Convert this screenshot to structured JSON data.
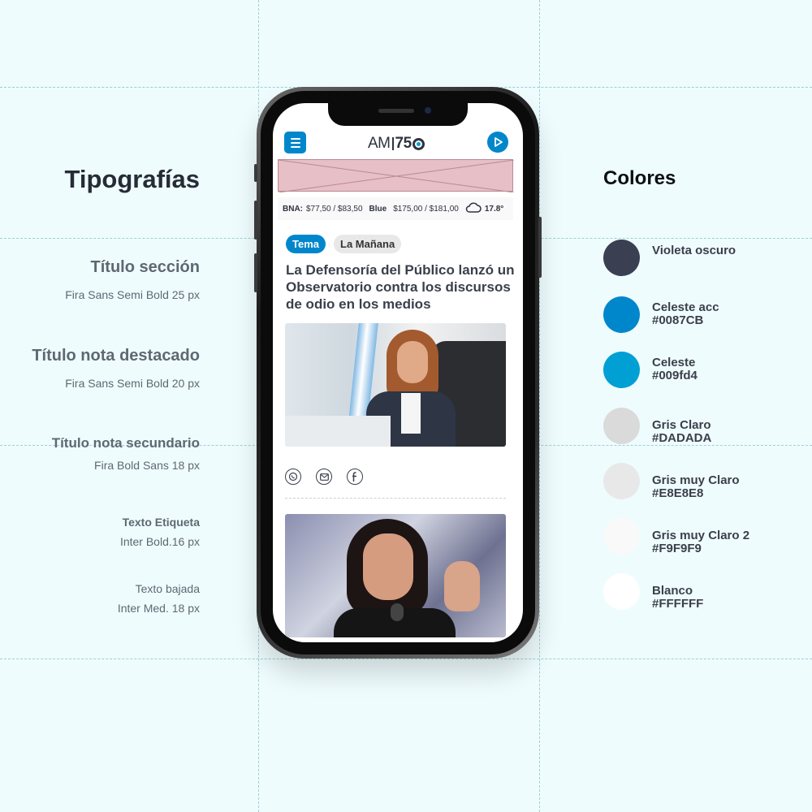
{
  "typography": {
    "title": "Tipografías",
    "items": [
      {
        "name": "Título sección",
        "spec": "Fira Sans Semi Bold 25 px"
      },
      {
        "name": "Título nota destacado",
        "spec": "Fira Sans Semi Bold 20 px"
      },
      {
        "name": "Título nota secundario",
        "spec": "Fira Bold Sans 18 px"
      },
      {
        "name": "Texto Etiqueta",
        "spec": "Inter Bold.16 px"
      },
      {
        "name": "Texto bajada",
        "spec": "Inter Med. 18 px"
      }
    ]
  },
  "colors": {
    "title": "Colores",
    "items": [
      {
        "name": "Violeta oscuro",
        "hex": "",
        "swatch": "#3A3F52"
      },
      {
        "name": "Celeste acc",
        "hex": "#0087CB",
        "swatch": "#0087CB"
      },
      {
        "name": "Celeste",
        "hex": "#009fd4",
        "swatch": "#009FD4"
      },
      {
        "name": "Gris Claro",
        "hex": "#DADADA",
        "swatch": "#DADADA"
      },
      {
        "name": "Gris muy Claro",
        "hex": "#E8E8E8",
        "swatch": "#E8E8E8"
      },
      {
        "name": "Gris muy Claro 2",
        "hex": "#F9F9F9",
        "swatch": "#F9F9F9"
      },
      {
        "name": "Blanco",
        "hex": "#FFFFFF",
        "swatch": "#FFFFFF"
      }
    ]
  },
  "app": {
    "logo": {
      "am": "AM",
      "num": "75"
    },
    "menu_icon": "hamburger-menu-icon",
    "play_icon": "play-icon",
    "ticker": {
      "bna_label": "BNA:",
      "bna_value": "$77,50 / $83,50",
      "blue_label": "Blue",
      "blue_value": "$175,00 / $181,00",
      "weather_icon": "cloud-icon",
      "temperature": "17.8°"
    },
    "tags": {
      "primary": "Tema",
      "secondary": "La Mañana"
    },
    "headline": "La Defensoría del Público lanzó un Observatorio contra los discursos de odio en los medios",
    "share_icons": [
      "whatsapp-icon",
      "mail-icon",
      "facebook-icon"
    ]
  }
}
